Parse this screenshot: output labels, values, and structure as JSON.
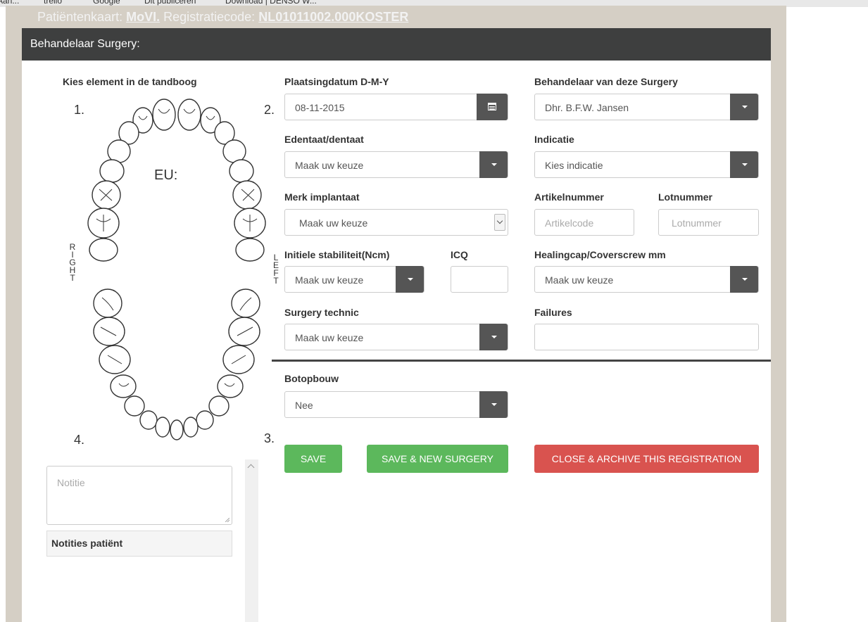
{
  "browser": {
    "bookmarks": [
      "Aan...",
      "trello",
      "Google",
      "Dit publiceren",
      "Download | DENSO W..."
    ]
  },
  "header": {
    "ghost_label_1": "Patiëntenkaart:",
    "ghost_value_1": "MoVI.",
    "ghost_label_2": "Registratiecode:",
    "ghost_value_2": "NL01011002.000KOSTER"
  },
  "panel": {
    "title": "Behandelaar Surgery:"
  },
  "teeth": {
    "heading": "Kies element in de tandboog",
    "q1": "1.",
    "q2": "2.",
    "q3": "3.",
    "q4": "4.",
    "eu_label": "EU:",
    "right_label": "RIGHT",
    "left_label": "LEFT"
  },
  "form": {
    "date_label": "Plaatsingdatum D-M-Y",
    "date_value": "08-11-2015",
    "practitioner_label": "Behandelaar van deze Surgery",
    "practitioner_value": "Dhr.  B.F.W.  Jansen",
    "edentate_label": "Edentaat/dentaat",
    "edentate_value": "Maak uw keuze",
    "indication_label": "Indicatie",
    "indication_value": "Kies indicatie",
    "brand_label": "Merk implantaat",
    "brand_value": "Maak uw keuze",
    "article_label": "Artikelnummer",
    "article_placeholder": "Artikelcode",
    "lot_label": "Lotnummer",
    "lot_placeholder": "Lotnummer",
    "stability_label": "Initiele stabiliteit(Ncm)",
    "stability_value": "Maak uw keuze",
    "icq_label": "ICQ",
    "icq_value": "",
    "healing_label": "Healingcap/Coverscrew mm",
    "healing_value": "Maak uw keuze",
    "technic_label": "Surgery technic",
    "technic_value": "Maak uw keuze",
    "failures_label": "Failures",
    "failures_value": "",
    "bone_label": "Botopbouw",
    "bone_value": "Nee"
  },
  "actions": {
    "save": "SAVE",
    "save_new": "SAVE & NEW SURGERY",
    "close_archive": "CLOSE & ARCHIVE THIS REGISTRATION"
  },
  "notes": {
    "placeholder": "Notitie",
    "heading": "Notities patiënt"
  },
  "colors": {
    "header_bg": "#3e3f3f",
    "page_bg": "#d5cfc5",
    "save_green": "#5cb85c",
    "archive_red": "#d9534f",
    "select_caret": "#555555"
  }
}
